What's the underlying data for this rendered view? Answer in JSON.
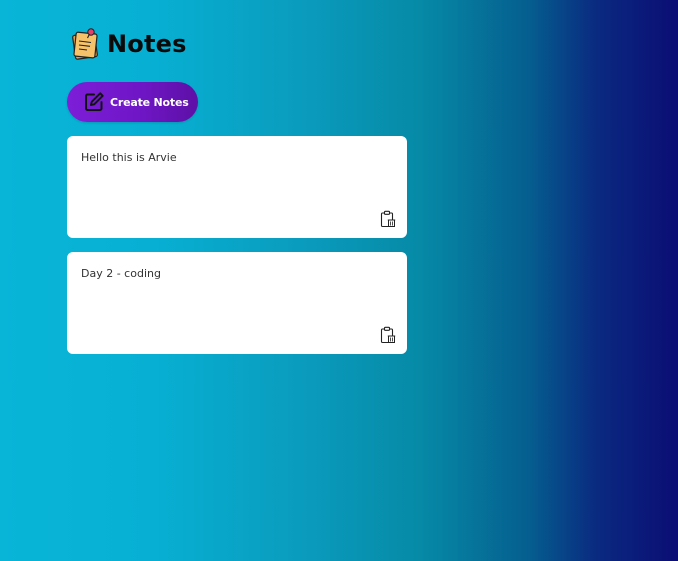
{
  "app": {
    "title": "Notes",
    "logo_icon": "sticky-note-icon"
  },
  "toolbar": {
    "create_label": "Create Notes",
    "create_icon": "edit-icon"
  },
  "notes": [
    {
      "text": "Hello this is Arvie",
      "delete_icon": "clipboard-delete-icon"
    },
    {
      "text": "Day 2 - coding",
      "delete_icon": "clipboard-delete-icon"
    }
  ],
  "colors": {
    "background_start": "#08b5d7",
    "background_end": "#0b0d74",
    "button_start": "#7d1ed8",
    "button_end": "#5d10a6",
    "note_background": "#ffffff"
  }
}
